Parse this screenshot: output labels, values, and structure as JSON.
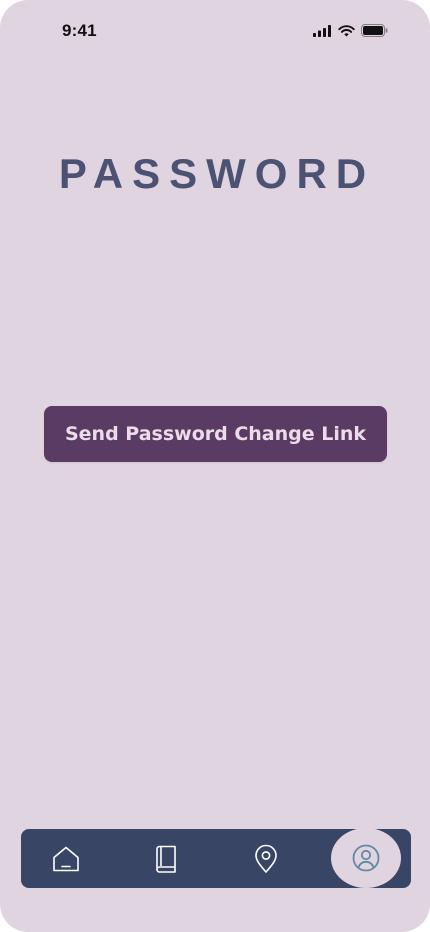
{
  "status_bar": {
    "time": "9:41",
    "icons": [
      "cellular-signal-icon",
      "wifi-icon",
      "battery-icon"
    ]
  },
  "page": {
    "title": "PASSWORD"
  },
  "actions": {
    "send_link_label": "Send Password Change Link"
  },
  "bottom_nav": {
    "items": [
      {
        "icon": "home-icon",
        "active": false
      },
      {
        "icon": "book-icon",
        "active": false
      },
      {
        "icon": "location-pin-icon",
        "active": false
      },
      {
        "icon": "profile-icon",
        "active": true
      }
    ]
  },
  "colors": {
    "background": "#e1d4e1",
    "title": "#4b5272",
    "button": "#5a3b63",
    "button_text": "#ebdcea",
    "nav_bar": "#394564",
    "nav_active_icon": "#5f8aa2"
  }
}
